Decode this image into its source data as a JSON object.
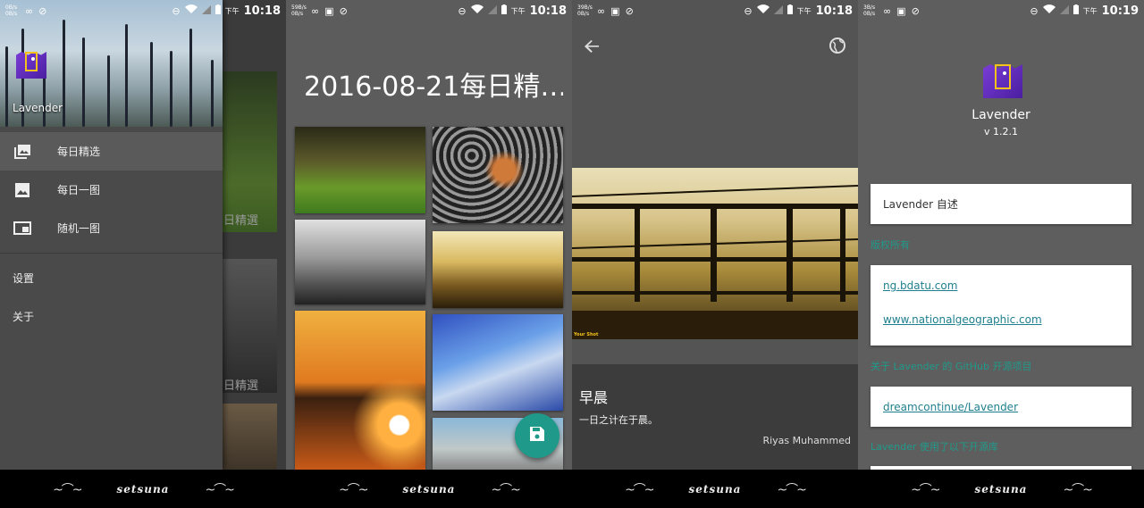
{
  "status": {
    "s1": {
      "speed_up": "0B/s",
      "speed_down": "0B/s",
      "ampm": "下午",
      "time": "10:18"
    },
    "s2": {
      "speed_up": "59B/s",
      "speed_down": "0B/s",
      "ampm": "下午",
      "time": "10:18"
    },
    "s3": {
      "speed_up": "39B/s",
      "speed_down": "0B/s",
      "ampm": "下午",
      "time": "10:18"
    },
    "s4": {
      "speed_up": "3B/s",
      "speed_down": "0B/s",
      "ampm": "下午",
      "time": "10:19"
    }
  },
  "navbar": {
    "brand": "setsuna"
  },
  "drawer": {
    "app_name": "Lavender",
    "items": [
      {
        "label": "每日精选",
        "icon": "photo-library-icon",
        "active": true
      },
      {
        "label": "每日一图",
        "icon": "image-icon",
        "active": false
      },
      {
        "label": "随机一图",
        "icon": "picture-in-picture-icon",
        "active": false
      }
    ],
    "settings_label": "设置",
    "about_label": "关于",
    "behind_labels": [
      "日精選",
      "日精選"
    ]
  },
  "gallery": {
    "title": "2016-08-21每日精…"
  },
  "detail": {
    "caption_brand": "Your Shot",
    "title": "早晨",
    "subtitle": "一日之计在于晨。",
    "author": "Riyas Muhammed"
  },
  "about": {
    "app_name": "Lavender",
    "version": "v 1.2.1",
    "intro_label": "Lavender 自述",
    "section1": "版权所有",
    "links1": [
      "ng.bdatu.com",
      "www.nationalgeographic.com"
    ],
    "section2": "关于 Lavender 的 GitHub 开源项目",
    "links2": [
      "dreamcontinue/Lavender"
    ],
    "section3": "Lavender 使用了以下开源库"
  },
  "colors": {
    "accent": "#1f9a8a",
    "logo_purple": "#5a2bc2",
    "logo_yellow": "#f4c21b"
  }
}
